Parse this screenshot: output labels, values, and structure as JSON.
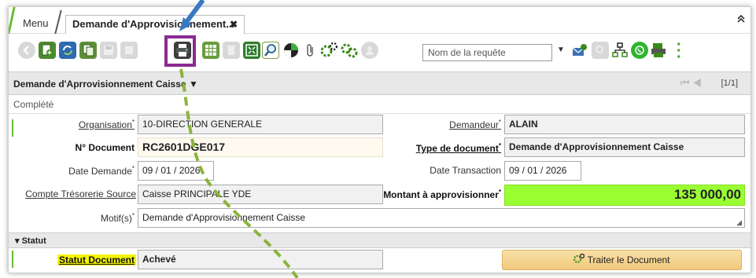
{
  "tabs": {
    "menu": "Menu",
    "active": "Demande d'Approvisionnement...",
    "close": "✖"
  },
  "toolbar": {
    "query_placeholder": "Nom de la requête"
  },
  "header": {
    "title": "Demande d'Aprrovisionnement Caisse",
    "pager": "[1/1]"
  },
  "status": {
    "text": "Complété"
  },
  "form": {
    "organisation_label": "Organisation",
    "organisation_value": "10-DIRECTION GENERALE",
    "demandeur_label": "Demandeur",
    "demandeur_value": "ALAIN",
    "ndocument_label": "N° Document",
    "ndocument_value": "RC2601DGE017",
    "typedoc_label": "Type de document",
    "typedoc_value": "Demande d'Approvisionnement Caisse",
    "datedemande_label": "Date Demande",
    "datedemande_value": "09 / 01 / 2026",
    "datetransaction_label": "Date Transaction",
    "datetransaction_value": "09 / 01 / 2026",
    "compte_label": "Compte Trésorerie Source",
    "compte_value": "Caisse PRINCIPALE YDE",
    "montant_label": "Montant à approvisionner",
    "montant_value": "135 000,00",
    "motif_label": "Motif(s)",
    "motif_value": "Demande d'Approvisionnement Caisse"
  },
  "statut": {
    "section_title": "Statut",
    "label": "Statut Document",
    "value": "Achevé",
    "button": "Traiter le Document"
  },
  "colors": {
    "accent_green": "#66bb33",
    "highlight_box": "#8b2a8f",
    "amount_bg": "#99ff33",
    "arrow_blue": "#3a78c2",
    "dashed_line": "#8bb43c"
  }
}
